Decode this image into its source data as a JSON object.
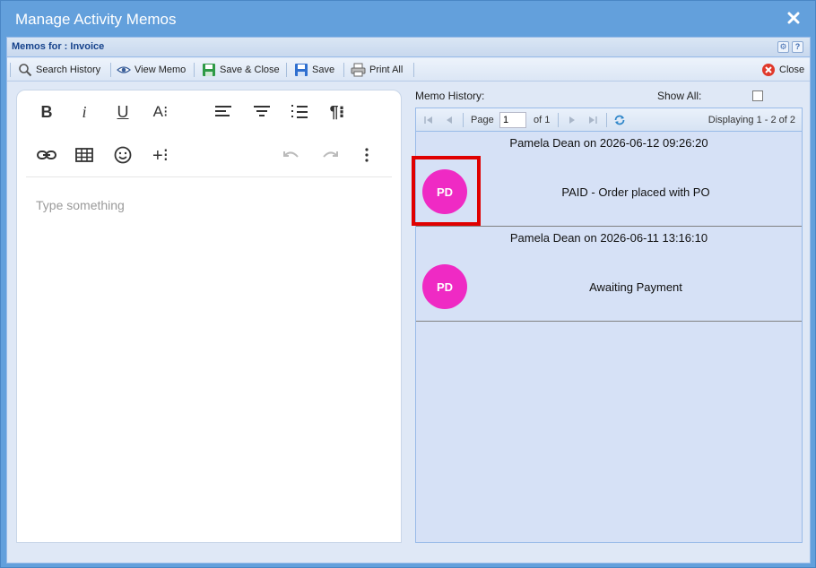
{
  "window": {
    "title": "Manage Activity Memos"
  },
  "panel": {
    "title": "Memos for : Invoice"
  },
  "toolbar": {
    "search_history": "Search History",
    "view_memo": "View Memo",
    "save_close": "Save & Close",
    "save": "Save",
    "print_all": "Print All",
    "close": "Close"
  },
  "editor": {
    "placeholder": "Type something"
  },
  "history": {
    "label": "Memo History:",
    "show_all_label": "Show All:",
    "pager": {
      "page_label": "Page",
      "page_value": "1",
      "of_label": "of 1",
      "displaying": "Displaying 1 - 2 of 2"
    },
    "memos": [
      {
        "header": "Pamela Dean on 2026-06-12 09:26:20",
        "initials": "PD",
        "text": "PAID - Order placed with PO"
      },
      {
        "header": "Pamela Dean on 2026-06-11 13:16:10",
        "initials": "PD",
        "text": "Awaiting Payment"
      }
    ]
  },
  "colors": {
    "avatar": "#ef2ac4",
    "highlight": "#e00000",
    "title_bar": "#63a0dc"
  }
}
